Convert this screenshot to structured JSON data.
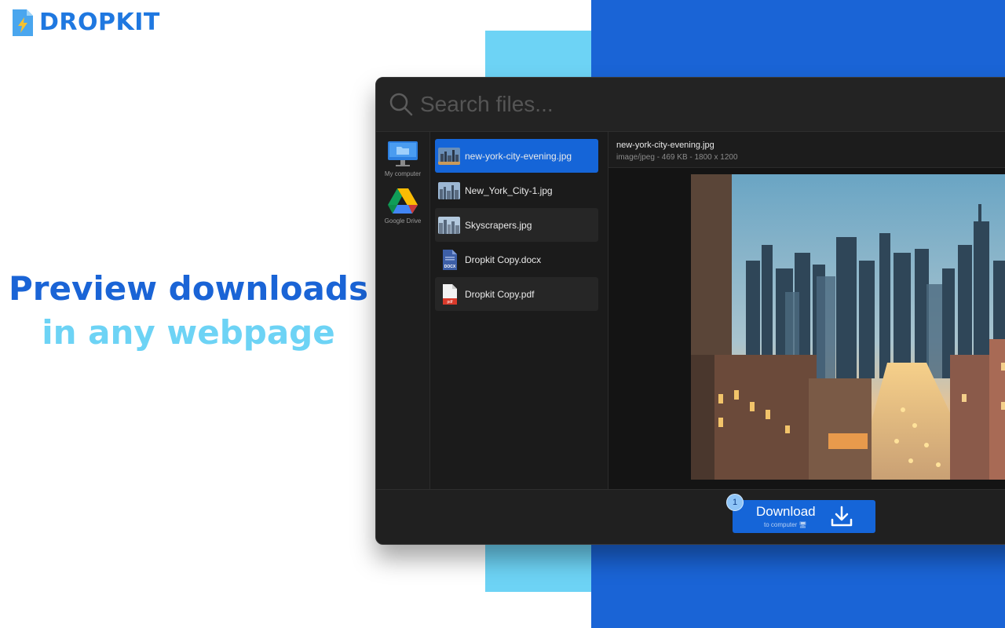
{
  "brand": {
    "name": "DROPKIT"
  },
  "headline": {
    "line1": "Preview downloads",
    "line2": "in any webpage"
  },
  "colors": {
    "accent_blue": "#1a64d6",
    "accent_cyan": "#6dd3f5",
    "button_blue": "#1565d8"
  },
  "search": {
    "placeholder": "Search files..."
  },
  "sources": [
    {
      "label": "My computer",
      "icon": "computer-icon"
    },
    {
      "label": "Google Drive",
      "icon": "google-drive-icon"
    }
  ],
  "files": [
    {
      "name": "new-york-city-evening.jpg",
      "type": "image",
      "selected": true
    },
    {
      "name": "New_York_City-1.jpg",
      "type": "image",
      "selected": false
    },
    {
      "name": "Skyscrapers.jpg",
      "type": "image",
      "selected": false
    },
    {
      "name": "Dropkit Copy.docx",
      "type": "docx",
      "selected": false
    },
    {
      "name": "Dropkit Copy.pdf",
      "type": "pdf",
      "selected": false
    }
  ],
  "preview": {
    "filename": "new-york-city-evening.jpg",
    "meta": "image/jpeg - 469 KB - 1800 x 1200"
  },
  "download": {
    "label": "Download",
    "sublabel": "to computer 🖥",
    "badge": "1"
  }
}
